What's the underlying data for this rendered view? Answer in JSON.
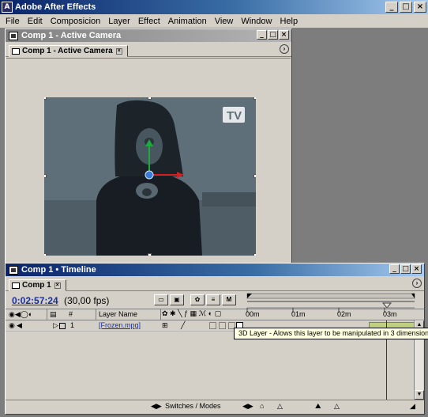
{
  "app": {
    "title": "Adobe After Effects",
    "icon_letter": "A"
  },
  "menu": [
    "File",
    "Edit",
    "Composicion",
    "Layer",
    "Effect",
    "Animation",
    "View",
    "Window",
    "Help"
  ],
  "comp_window": {
    "title": "Comp 1 - Active Camera",
    "tab_label": "Comp 1 - Active Camera",
    "logo_text": "TV"
  },
  "timeline": {
    "title": "Comp 1 • Timeline",
    "tab_label": "Comp 1",
    "timecode": "0:02:57:24",
    "fps": "(30,00 fps)",
    "col_layer_name": "Layer Name",
    "col_number": "#",
    "layer_number": "1",
    "layer_name": "[Frozen.mpg]",
    "ruler_labels": [
      "00m",
      "01m",
      "02m",
      "03m"
    ],
    "switches_label": "Switches / Modes",
    "tooltip": "3D Layer - Alows this layer to be manipulated in 3 dimensions"
  },
  "colors": {
    "title_active": "#0a246a",
    "title_gradient_end": "#a6caf0",
    "timecode": "#1a2e9a",
    "current_time_indicator": "#c00000",
    "work_bar": "#bfcf80",
    "canvas_bg": "#5e6f79",
    "tooltip_bg": "#ffffe1"
  }
}
